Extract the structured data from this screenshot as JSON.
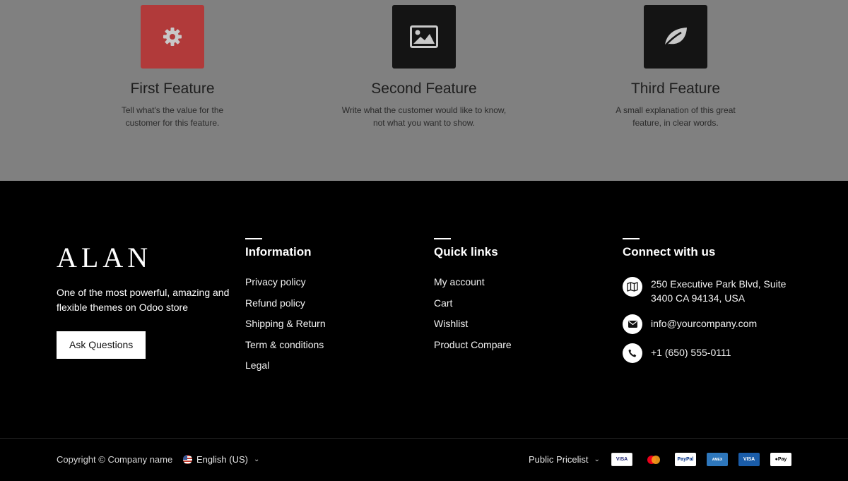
{
  "features": [
    {
      "title": "First Feature",
      "desc_line1": "Tell what's the value for the",
      "desc_line2": "customer for this feature.",
      "icon": "gear-icon",
      "tile_color": "#b13a3a"
    },
    {
      "title": "Second Feature",
      "desc_line1": "Write what the customer would like to know,",
      "desc_line2": "not what you want to show.",
      "icon": "image-icon",
      "tile_color": "#141414"
    },
    {
      "title": "Third Feature",
      "desc_line1": "A small explanation of this great",
      "desc_line2": "feature, in clear words.",
      "icon": "leaf-icon",
      "tile_color": "#141414"
    }
  ],
  "brand": {
    "logo": "ALAN",
    "tagline": "One of the most powerful, amazing and flexible themes on Odoo store",
    "cta": "Ask Questions"
  },
  "information": {
    "heading": "Information",
    "links": [
      "Privacy policy",
      "Refund policy",
      "Shipping & Return",
      "Term & conditions",
      "Legal"
    ]
  },
  "quick_links": {
    "heading": "Quick links",
    "links": [
      "My account",
      "Cart",
      "Wishlist",
      "Product Compare"
    ]
  },
  "connect": {
    "heading": "Connect with us",
    "address_line1": "250 Executive Park Blvd, Suite",
    "address_line2": "3400 CA 94134, USA",
    "email": "info@yourcompany.com",
    "phone": "+1 (650) 555-0111"
  },
  "bottom": {
    "copyright": "Copyright © Company name",
    "language": "English (US)",
    "pricelist": "Public Pricelist",
    "payment_labels": {
      "visa": "VISA",
      "paypal": "PayPal",
      "amex": "AMEX",
      "visa_electron": "VISA",
      "apple_pay": "Pay"
    }
  }
}
